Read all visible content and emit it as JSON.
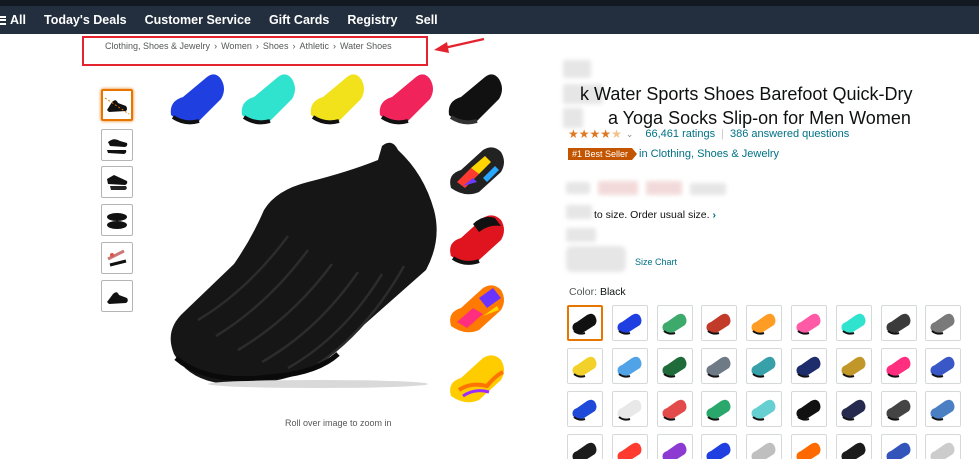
{
  "nav": {
    "items": [
      "All",
      "Today's Deals",
      "Customer Service",
      "Gift Cards",
      "Registry",
      "Sell"
    ]
  },
  "breadcrumb": [
    "Clothing, Shoes & Jewelry",
    "Women",
    "Shoes",
    "Athletic",
    "Water Shoes"
  ],
  "gallery": {
    "zoom_hint": "Roll over image to zoom in",
    "strip_colors": [
      "#1f3fe0",
      "#2fe3cf",
      "#f1e21c",
      "#f0245a",
      "#111111"
    ],
    "side_colors": [
      [
        "#ff3b30",
        "#ffd400",
        "#2aa7ff",
        "#6b3cff"
      ],
      [
        "#e0141e",
        "#111111"
      ],
      [
        "#ff7a00",
        "#ff2e7e",
        "#6b33ff"
      ],
      [
        "#ffcc00",
        "#ff7300",
        "#9b2cff"
      ]
    ]
  },
  "product": {
    "title_line1": "k Water Sports Shoes Barefoot Quick-Dry",
    "title_line2": "a Yoga Socks Slip-on for Men Women",
    "ratings": "66,461 ratings",
    "answered": "386 answered questions",
    "best_seller_badge": "#1 Best Seller",
    "best_seller_category": "in Clothing, Shoes & Jewelry",
    "size_note": "to size. Order usual size.",
    "size_note_arrow": "›",
    "size_chart": "Size Chart",
    "color_label": "Color:",
    "color_value": "Black"
  },
  "swatches": [
    [
      "#111111",
      "#1f3fe0",
      "#3da96b",
      "#c23a2a",
      "#ff9c24",
      "#ff5aa5",
      "#2fe3cf",
      "#3b3b3b",
      "#7a7a7a"
    ],
    [
      "#f2d12a",
      "#4fa3e6",
      "#1f6b3a",
      "#6e7a85",
      "#37a0a8",
      "#1d2c6a",
      "#c2972a",
      "#ff2e7e",
      "#3a57c7"
    ],
    [
      "#1e49d9",
      "#e8e8e8",
      "#e34b4b",
      "#2aa86b",
      "#66cfd1",
      "#111111",
      "#262a4e",
      "#444444",
      "#4b7fc4"
    ],
    [
      "#1c1c1c",
      "#ff3b30",
      "#8c3ad1",
      "#1f3fe0",
      "#bfbfbf",
      "#ff6a00",
      "#1b1b1b",
      "#3355bb",
      "#cccccc"
    ]
  ],
  "colors": {
    "nav_bg": "#232f3e",
    "accent_orange": "#e77600",
    "link_teal": "#007185",
    "highlight_red": "#e4232f"
  }
}
